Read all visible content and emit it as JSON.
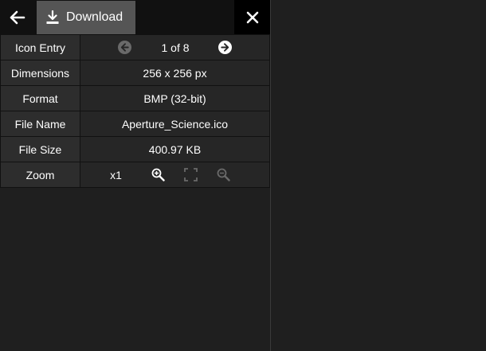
{
  "toolbar": {
    "back_icon": "arrow-left-icon",
    "download_icon": "download-icon",
    "download_label": "Download",
    "close_icon": "close-icon"
  },
  "info": {
    "icon_entry": {
      "label": "Icon Entry",
      "value": "1 of 8"
    },
    "dimensions": {
      "label": "Dimensions",
      "value": "256 x 256 px"
    },
    "format": {
      "label": "Format",
      "value": "BMP (32-bit)"
    },
    "file_name": {
      "label": "File Name",
      "value": "Aperture_Science.ico"
    },
    "file_size": {
      "label": "File Size",
      "value": "400.97 KB"
    },
    "zoom": {
      "label": "Zoom",
      "value": "x1"
    }
  },
  "colors": {
    "background": "#1f1f1f",
    "toolbar": "#111111",
    "download_button": "#555555",
    "close_button": "#000000",
    "disabled_icon": "#6a6a6a"
  }
}
